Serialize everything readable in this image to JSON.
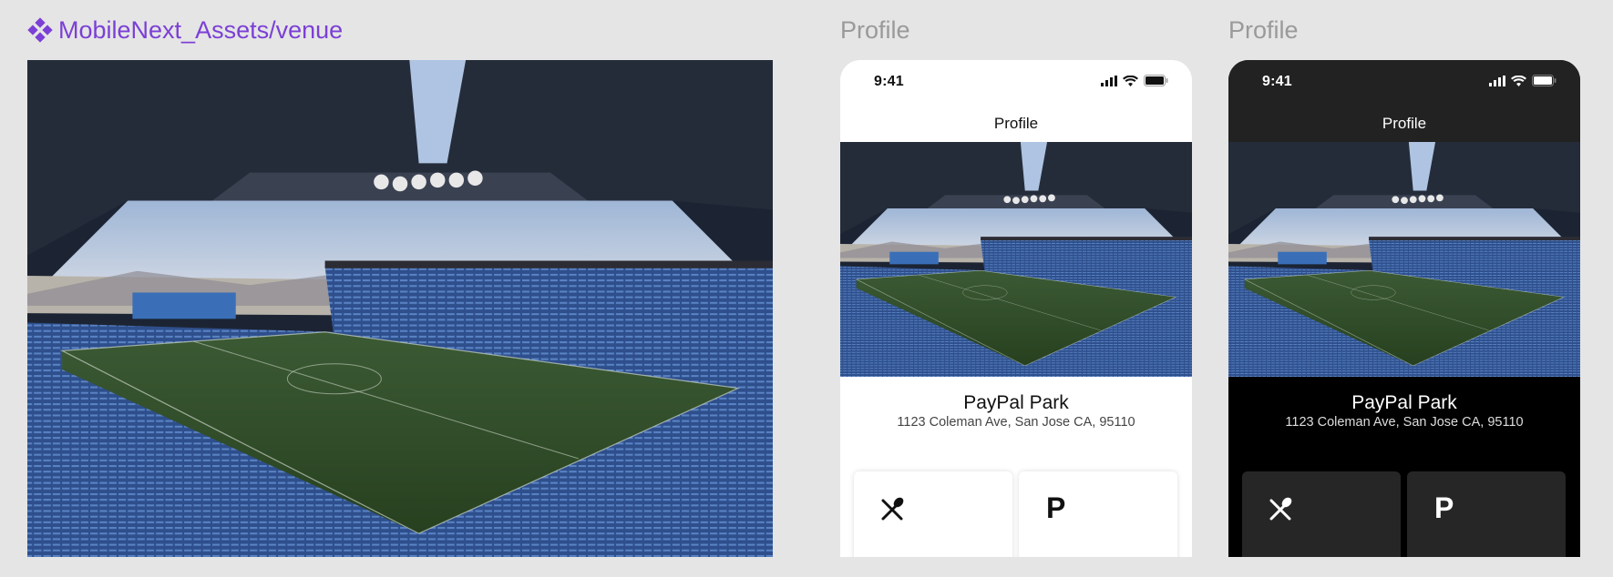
{
  "colors": {
    "component_accent": "#7b3fd6",
    "label_gray": "#9a9a9a",
    "canvas_bg": "#e5e5e5",
    "dark_bar": "#222222"
  },
  "asset_frame": {
    "label": "MobileNext_Assets/venue",
    "icon": "component-icon"
  },
  "light_frame": {
    "label": "Profile",
    "status": {
      "time": "9:41",
      "icons": [
        "signal-icon",
        "wifi-icon",
        "battery-icon"
      ]
    },
    "nav_title": "Profile",
    "venue": {
      "name": "PayPal Park",
      "address": "1123 Coleman Ave, San Jose CA, 95110"
    },
    "amenities": [
      {
        "icon": "utensils-icon"
      },
      {
        "icon": "parking-icon",
        "glyph": "P"
      }
    ]
  },
  "dark_frame": {
    "label": "Profile",
    "status": {
      "time": "9:41",
      "icons": [
        "signal-icon",
        "wifi-icon",
        "battery-icon"
      ]
    },
    "nav_title": "Profile",
    "venue": {
      "name": "PayPal Park",
      "address": "1123 Coleman Ave, San Jose CA, 95110"
    },
    "amenities": [
      {
        "icon": "utensils-icon"
      },
      {
        "icon": "parking-icon",
        "glyph": "P"
      }
    ]
  }
}
